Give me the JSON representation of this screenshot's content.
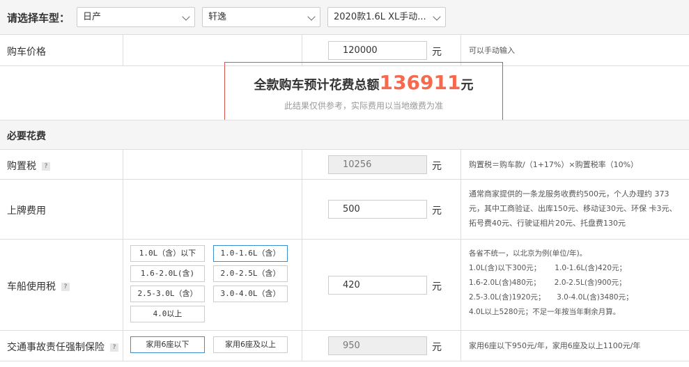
{
  "header": {
    "label": "请选择车型：",
    "brand": "日产",
    "series": "轩逸",
    "model": "2020款1.6L XL手动..."
  },
  "price": {
    "label": "购车价格",
    "value": "120000",
    "unit": "元",
    "note": "可以手动输入"
  },
  "total": {
    "prefix": "全款购车预计花费总额",
    "amount": "136911",
    "suffix": "元",
    "subtext": "此结果仅供参考，实际费用以当地缴费为准"
  },
  "section": {
    "title": "必要花费"
  },
  "purchase_tax": {
    "label": "购置税",
    "help": "?",
    "value": "10256",
    "unit": "元",
    "note": "购置税＝购车款/（1+17%）×购置税率（10%）"
  },
  "registration": {
    "label": "上牌费用",
    "value": "500",
    "unit": "元",
    "note_lines": [
      "通常商家提供的一条龙服务收费约500元，个人办理约 373",
      "元，其中工商验证、出库150元、移动证30元、环保 卡3元、",
      "拓号费40元、行驶证相片20元、托盘费130元"
    ]
  },
  "vehicle_tax": {
    "label": "车船使用税",
    "help": "?",
    "value": "420",
    "unit": "元",
    "options": [
      "1.0L（含）以下",
      "1.0-1.6L（含）",
      "1.6-2.0L(含)",
      "2.0-2.5L（含）",
      "2.5-3.0L（含）",
      "3.0-4.0L（含）",
      "4.0以上"
    ],
    "selected_option": "1.0-1.6L（含）",
    "note_lines": [
      "各省不统一，以北京为例(单位/年)。",
      "1.0L(含)以下300元；      1.0-1.6L(含)420元；",
      "1.6-2.0L(含)480元；      2.0-2.5L(含)900元；",
      "2.5-3.0L(含)1920元；     3.0-4.0L(含)3480元；",
      "4.0L以上5280元；不足一年按当年剩余月算。"
    ]
  },
  "insurance": {
    "label": "交通事故责任强制保险",
    "help": "?",
    "value": "950",
    "unit": "元",
    "options": [
      "家用6座以下",
      "家用6座及以上"
    ],
    "selected_option": "家用6座以下",
    "note": "家用6座以下950元/年，家用6座及以上1100元/年"
  }
}
